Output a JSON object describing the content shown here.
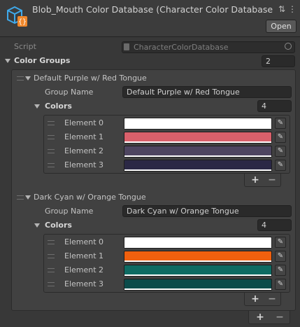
{
  "header": {
    "title": "Blob_Mouth Color Database (Character Color Database)",
    "open_label": "Open",
    "icon": "scriptable-object-icon",
    "menu_icons": [
      "sliders-icon",
      "kebab-menu-icon"
    ]
  },
  "script_field": {
    "label": "Script",
    "value": "CharacterColorDatabase"
  },
  "color_groups": {
    "label": "Color Groups",
    "count": "2",
    "groups": [
      {
        "title": "Default Purple w/ Red Tongue",
        "name_label": "Group Name",
        "name_value": "Default Purple w/ Red Tongue",
        "colors_label": "Colors",
        "colors_count": "4",
        "elements": [
          {
            "label": "Element 0",
            "color": "#FFFFFF"
          },
          {
            "label": "Element 1",
            "color": "#D9606B"
          },
          {
            "label": "Element 2",
            "color": "#4E4560"
          },
          {
            "label": "Element 3",
            "color": "#2B2845"
          }
        ]
      },
      {
        "title": "Dark Cyan w/ Orange Tongue",
        "name_label": "Group Name",
        "name_value": "Dark Cyan w/ Orange Tongue",
        "colors_label": "Colors",
        "colors_count": "4",
        "elements": [
          {
            "label": "Element 0",
            "color": "#FFFFFF"
          },
          {
            "label": "Element 1",
            "color": "#F0600E"
          },
          {
            "label": "Element 2",
            "color": "#0E6B63"
          },
          {
            "label": "Element 3",
            "color": "#0B4B4A"
          }
        ]
      }
    ]
  },
  "list_buttons": {
    "add": "+",
    "remove": "−"
  }
}
